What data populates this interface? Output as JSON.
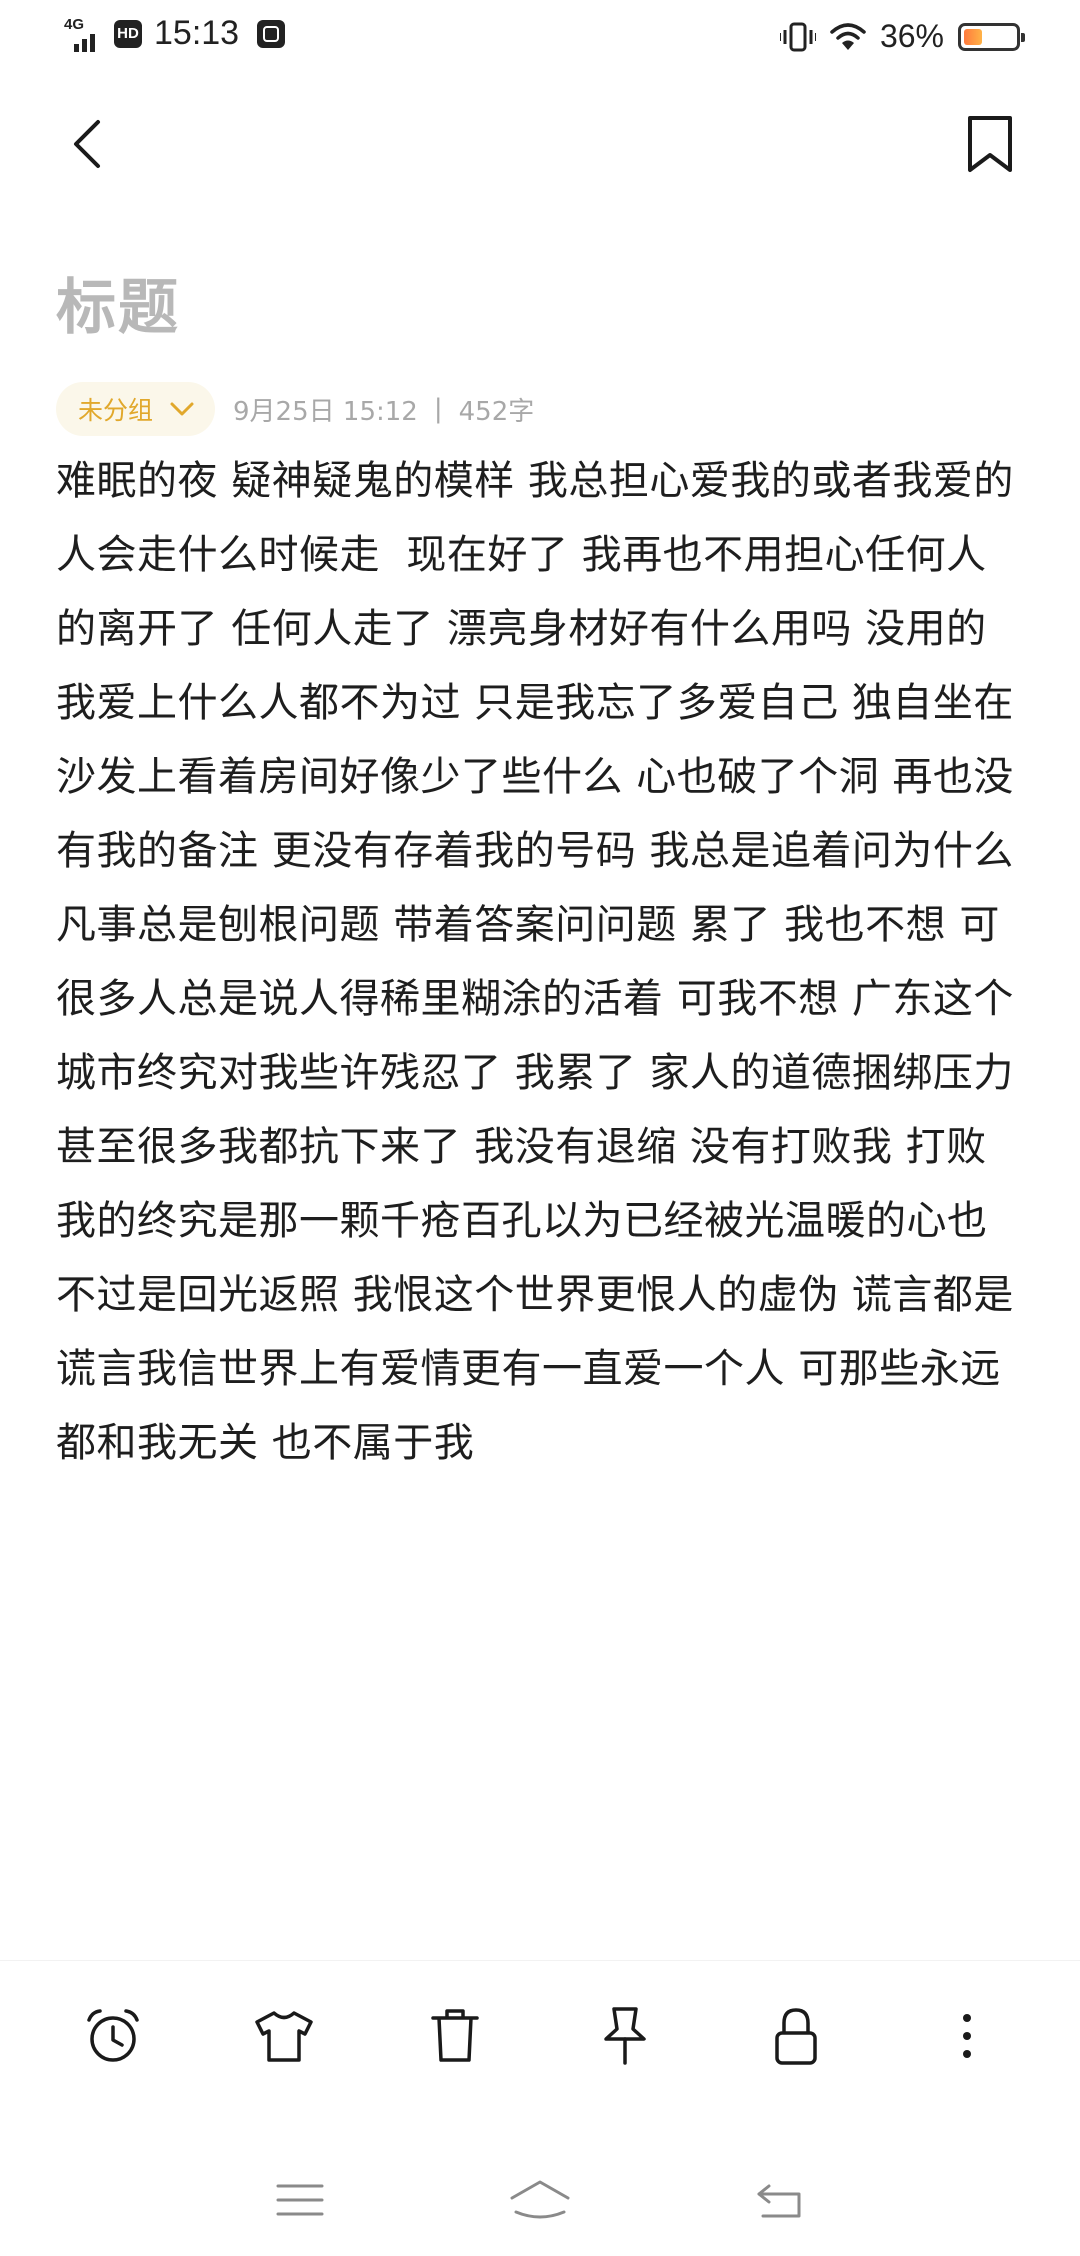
{
  "status_bar": {
    "network": "4G",
    "hd": "HD",
    "time": "15:13",
    "battery_percent_text": "36%",
    "battery_level": 0.36,
    "icons": [
      "signal-icon",
      "hd-icon",
      "app-notification-icon",
      "vibrate-icon",
      "wifi-icon",
      "battery-icon"
    ]
  },
  "header": {
    "back_icon": "chevron-left-icon",
    "bookmark_icon": "bookmark-icon"
  },
  "note": {
    "title_placeholder": "标题",
    "group": "未分组",
    "group_icon": "chevron-down-icon",
    "date": "9月25日 15:12",
    "separator": "|",
    "char_count": "452字",
    "body": "难眠的夜 疑神疑鬼的模样 我总担心爱我的或者我爱的人会走什么时候走  现在好了 我再也不用担心任何人的离开了 任何人走了 漂亮身材好有什么用吗 没用的 我爱上什么人都不为过 只是我忘了多爱自己 独自坐在沙发上看着房间好像少了些什么 心也破了个洞 再也没有我的备注 更没有存着我的号码 我总是追着问为什么 凡事总是刨根问题 带着答案问问题 累了 我也不想 可很多人总是说人得稀里糊涂的活着 可我不想 广东这个城市终究对我些许残忍了 我累了 家人的道德捆绑压力 甚至很多我都抗下来了 我没有退缩 没有打败我 打败我的终究是那一颗千疮百孔以为已经被光温暖的心也不过是回光返照 我恨这个世界更恨人的虚伪 谎言都是谎言我信世界上有爱情更有一直爱一个人 可那些永远都和我无关 也不属于我"
  },
  "toolbar": {
    "items": [
      "alarm-clock-icon",
      "tshirt-icon",
      "trash-icon",
      "pin-icon",
      "lock-icon",
      "more-vertical-icon"
    ]
  },
  "system_nav": {
    "items": [
      "menu-icon",
      "home-icon",
      "back-icon"
    ]
  },
  "colors": {
    "accent": "#e1a82c",
    "chip_bg": "#fbf7ea",
    "title_placeholder": "#b8b8b8",
    "meta": "#a8a8a8",
    "body_text": "#1e1e1e"
  }
}
